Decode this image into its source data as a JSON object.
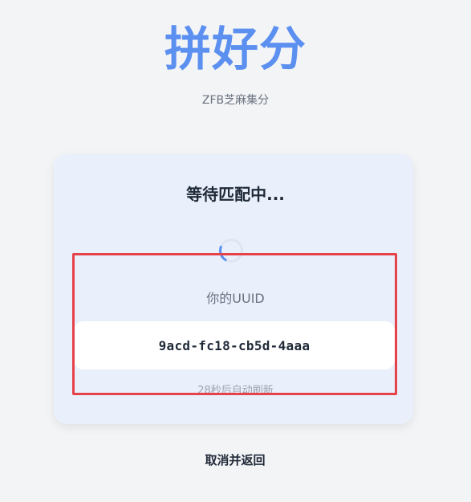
{
  "header": {
    "title": "拼好分",
    "subtitle": "ZFB芝麻集分"
  },
  "card": {
    "status_title": "等待匹配中...",
    "spinner_icon": "loading-spinner-icon",
    "uuid_label": "你的UUID",
    "uuid_value": "9acd-fc18-cb5d-4aaa",
    "refresh_text": "28秒后自动刷新"
  },
  "actions": {
    "cancel_label": "取消并返回"
  },
  "colors": {
    "accent": "#5b8ff0",
    "card_background": "#e9f0fc",
    "page_background": "#f3f4f6",
    "highlight_border": "#e5424a"
  }
}
